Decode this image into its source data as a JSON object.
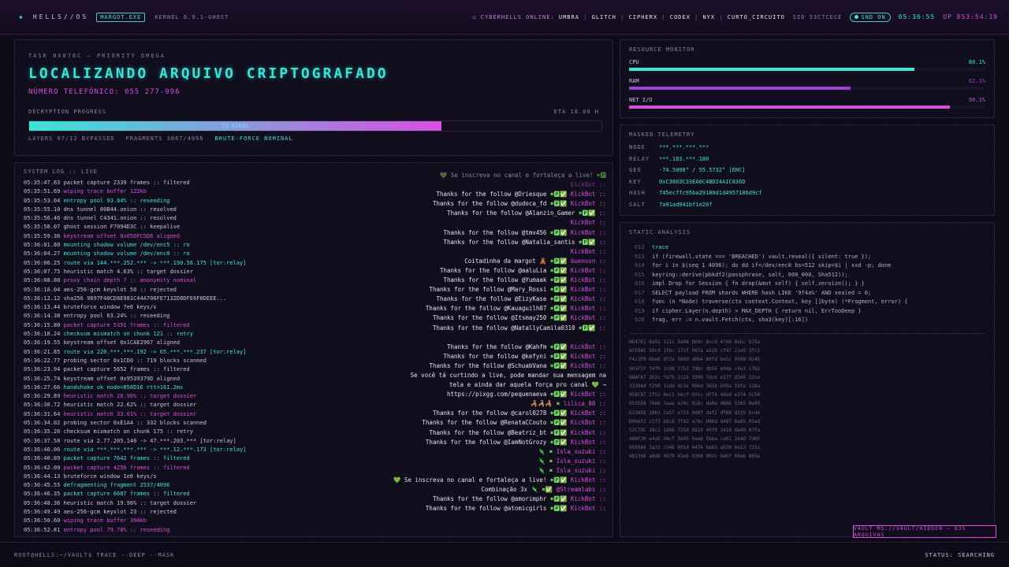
{
  "topbar": {
    "logo": "◈",
    "brand": "HELLS//OS",
    "host_badge": "MARGOT.EXE",
    "kernel": "KERNEL 6.9.1-GHOST",
    "online_icon": "network-icon",
    "online_label": "CYBERHELLS ONLINE:",
    "online_names": [
      "UMBRA",
      "GLITCH",
      "CIPHERX",
      "CODEX",
      "NYX",
      "CURTO_CIRCUITO"
    ],
    "sid": "SID 53C7CECE",
    "snd": "SND ON",
    "clock": "05:36:55",
    "uptime": "UP 853:54:19"
  },
  "task": {
    "subtitle": "TASK 0X070C — PRIORITY OMEGA",
    "title": "LOCALIZANDO ARQUIVO CRIPTOGRAFADO",
    "phone": "NÚMERO TELEFÔNICO: 055 277-996",
    "progress_label": "DECRYPTION PROGRESS",
    "eta": "ETA 18.09 H",
    "progress": 0.72,
    "progress_text": "72.8168%",
    "layers": "LAYERS 07/12 BYPASSED",
    "fragments": "FRAGMENTS 3067/4096",
    "bruteforce": "BRUTE-FORCE NOMINAL"
  },
  "syslog": {
    "header": "SYSTEM LOG :: LIVE",
    "rows": [
      {
        "t": "05:35:47.83",
        "m": "packet capture 2339 frames :: filtered",
        "c": "w"
      },
      {
        "t": "05:35:51.69",
        "m": "wiping trace buffer 122kb",
        "c": "m"
      },
      {
        "t": "05:35:53.04",
        "m": "entropy pool 93.84% :: reseeding",
        "c": "c"
      },
      {
        "t": "05:35:55.10",
        "m": "dns tunnel 80B44.onion :: resolved",
        "c": "w"
      },
      {
        "t": "05:35:56.46",
        "m": "dns tunnel C4341.onion :: resolved",
        "c": "w"
      },
      {
        "t": "05:35:58.07",
        "m": "ghost session F7094D3C :: keepalive",
        "c": "w"
      },
      {
        "t": "05:35:59.36",
        "m": "keystream offset 0x056FC5D6 aligned",
        "c": "m"
      },
      {
        "t": "05:36:01.80",
        "m": "mounting shadow volume /dev/enc5 :: ro",
        "c": "c"
      },
      {
        "t": "05:36:04.27",
        "m": "mounting shadow volume /dev/enc0 :: ro",
        "c": "c"
      },
      {
        "t": "05:36:06.25",
        "m": "route via 144.***.252.*** -> ***.190.56.175 [tor:relay]",
        "c": "c"
      },
      {
        "t": "05:36:07.75",
        "m": "heuristic match 4.63% :: target dossier",
        "c": "w"
      },
      {
        "t": "05:36:08.80",
        "m": "proxy chain depth 7 :: anonymity nominal",
        "c": "m"
      },
      {
        "t": "05:36:10.04",
        "m": "aes-256-gcm keyslot 50 :: rejected",
        "c": "w"
      },
      {
        "t": "05:36:12.12",
        "m": "sha256 9897F40CD8E981C44A706FE7132D8DFE6F8DEEE...",
        "c": "w"
      },
      {
        "t": "05:36:13.44",
        "m": "bruteforce window 7e6 keys/s",
        "c": "w"
      },
      {
        "t": "05:36:14.38",
        "m": "entropy pool 63.24% :: reseeding",
        "c": "w"
      },
      {
        "t": "05:36:15.80",
        "m": "packet capture 5351 frames :: filtered",
        "c": "m"
      },
      {
        "t": "05:36:18.24",
        "m": "checksum mismatch on chunk 121 :: retry",
        "c": "c"
      },
      {
        "t": "05:36:19.55",
        "m": "keystream offset 0x1CAE2967 aligned",
        "c": "w"
      },
      {
        "t": "05:36:21.85",
        "m": "route via 220.***.***.192 -> 65.***.***.237 [tor:relay]",
        "c": "c"
      },
      {
        "t": "05:36:22.77",
        "m": "probing sector 0x1CD0 :: 719 blocks scanned",
        "c": "w"
      },
      {
        "t": "05:36:23.94",
        "m": "packet capture 5652 frames :: filtered",
        "c": "w"
      },
      {
        "t": "05:36:25.74",
        "m": "keystream offset 0x9539379D aligned",
        "c": "w"
      },
      {
        "t": "05:36:27.66",
        "m": "handshake ok node=858D1E rtt=161.2ms",
        "c": "c"
      },
      {
        "t": "05:36:29.89",
        "m": "heuristic match 28.96% :: target dossier",
        "c": "m"
      },
      {
        "t": "05:36:30.72",
        "m": "heuristic match 22.62% :: target dossier",
        "c": "w"
      },
      {
        "t": "05:36:31.64",
        "m": "heuristic match 33.01% :: target dossier",
        "c": "m"
      },
      {
        "t": "05:36:34.02",
        "m": "probing sector 0xE1A4 :: 332 blocks scanned",
        "c": "w"
      },
      {
        "t": "05:36:35.26",
        "m": "checksum mismatch on chunk 175 :: retry",
        "c": "w"
      },
      {
        "t": "05:36:37.58",
        "m": "route via 2.77.205.140 -> 47.***.203.*** [tor:relay]",
        "c": "w"
      },
      {
        "t": "05:36:40.06",
        "m": "route via ***.***.***.*** -> ***.12.***.173 [tor:relay]",
        "c": "c"
      },
      {
        "t": "05:36:40.89",
        "m": "packet capture 7642 frames :: filtered",
        "c": "c"
      },
      {
        "t": "05:36:42.09",
        "m": "packet capture 4256 frames :: filtered",
        "c": "m"
      },
      {
        "t": "05:36:44.13",
        "m": "bruteforce window 1e6 keys/s",
        "c": "w"
      },
      {
        "t": "05:36:45.55",
        "m": "defragmenting fragment 2537/4096",
        "c": "c"
      },
      {
        "t": "05:36:46.35",
        "m": "packet capture 6687 frames :: filtered",
        "c": "c"
      },
      {
        "t": "05:36:48.36",
        "m": "heuristic match 19.96% :: target dossier",
        "c": "w"
      },
      {
        "t": "05:36:49.49",
        "m": "aes-256-gcm keyslot 23 :: rejected",
        "c": "w"
      },
      {
        "t": "05:36:50.60",
        "m": "wiping trace buffer 304kb",
        "c": "m"
      },
      {
        "t": "05:36:52.81",
        "m": "entropy pool 79.78% :: reseeding",
        "c": "m"
      }
    ]
  },
  "chat": {
    "rows": [
      {
        "text": "💚 Se inscreva no canal e fortaleça a live!",
        "icons": "✖🅿",
        "user": "",
        "dim": true
      },
      {
        "text": "",
        "icons": "",
        "user": "KickBot ::",
        "dim": true
      },
      {
        "text": "Thanks for the follow @Driesque",
        "icons": "✖🅿✅",
        "user": "KickBot ::",
        "dim": false
      },
      {
        "text": "Thanks for the follow @dudoca_fd",
        "icons": "✖🅿✅",
        "user": "KickBot ::",
        "dim": false
      },
      {
        "text": "Thanks for the follow @Alanzin_Gamer",
        "icons": "✖🅿✅",
        "user": "::",
        "dim": false
      },
      {
        "text": "",
        "icons": "",
        "user": "KickBot ::",
        "dim": false
      },
      {
        "text": "Thanks for the follow @tmv456",
        "icons": "✖🅿✅",
        "user": "KickBot ::",
        "dim": false
      },
      {
        "text": "Thanks for the follow @Natalia_santis",
        "icons": "✖🅿✅",
        "user": "::",
        "dim": false
      },
      {
        "text": "",
        "icons": "",
        "user": "KickBot ::",
        "dim": false
      },
      {
        "text": "Coitadinha da margot 🧸",
        "icons": "✖🅿✅",
        "user": "buenosn ::",
        "dim": false
      },
      {
        "text": "Thanks for the follow @aaluLia",
        "icons": "✖🅿✅",
        "user": "KickBot ::",
        "dim": false
      },
      {
        "text": "Thanks for the follow @Yumaak",
        "icons": "✖🅿✅",
        "user": "KickBot ::",
        "dim": false
      },
      {
        "text": "Thanks for the follow @Mary_Rossi",
        "icons": "✖🅿✅",
        "user": "KickBot ::",
        "dim": false
      },
      {
        "text": "Thanks for the follow @EizyKase",
        "icons": "✖🅿✅",
        "user": "KickBot ::",
        "dim": false
      },
      {
        "text": "Thanks for the follow @Kauaguilh07",
        "icons": "✖🅿✅",
        "user": "KickBot ::",
        "dim": false
      },
      {
        "text": "Thanks for the follow @Itsmay250",
        "icons": "✖🅿✅",
        "user": "KickBot ::",
        "dim": false
      },
      {
        "text": "Thanks for the follow @NatallyCamila0310",
        "icons": "✖🅿✅",
        "user": "::",
        "dim": false
      },
      {
        "text": "",
        "icons": "",
        "user": "",
        "dim": false
      },
      {
        "text": "Thanks for the follow @Kahfm",
        "icons": "✖🅿✅",
        "user": "KickBot ::",
        "dim": false
      },
      {
        "text": "Thanks for the follow @kefyni",
        "icons": "✖🅿✅",
        "user": "KickBot ::",
        "dim": false
      },
      {
        "text": "Thanks for the follow @SchuabVana",
        "icons": "✖🅿✅",
        "user": "KickBot ::",
        "dim": false
      },
      {
        "text": "Se você tá curtindo a live, pode mandar sua mensagem na",
        "icons": "",
        "user": "",
        "dim": false
      },
      {
        "text": "tela e ainda dar aquela força pro canal 💚 →",
        "icons": "",
        "user": "",
        "dim": false
      },
      {
        "text": "https://pixgg.com/pequenaeva",
        "icons": "✖🅿✅",
        "user": "KickBot ::",
        "dim": false
      },
      {
        "text": "🦂🦂🦂",
        "icons": "✖",
        "user": "lilica_80 ::",
        "dim": false
      },
      {
        "text": "Thanks for the follow @carol0278",
        "icons": "✖🅿✅",
        "user": "KickBot ::",
        "dim": false
      },
      {
        "text": "Thanks for the follow @RenataCCouto",
        "icons": "✖🅿✅",
        "user": "KickBot ::",
        "dim": false
      },
      {
        "text": "Thanks for the follow @Beatriz_bt",
        "icons": "✖🅿✅",
        "user": "KickBot ::",
        "dim": false
      },
      {
        "text": "Thanks for the follow @IamNotGrozy",
        "icons": "✖🅿✅",
        "user": "KickBot ::",
        "dim": false
      },
      {
        "text": "🦎",
        "icons": "✖",
        "user": "Isla_suzuki ::",
        "dim": false
      },
      {
        "text": "🦎",
        "icons": "✖",
        "user": "Isla_suzuki ::",
        "dim": false
      },
      {
        "text": "🦎",
        "icons": "✖",
        "user": "Isla_suzuki ::",
        "dim": false
      },
      {
        "text": "💚 Se inscreva no canal e fortaleça a live!",
        "icons": "✖🅿✅",
        "user": "KickBot ::",
        "dim": false
      },
      {
        "text": "Combinação 3x 🦎",
        "icons": "✖✅",
        "user": "@Streamlabs ::",
        "dim": false
      },
      {
        "text": "Thanks for the follow @amorimphr",
        "icons": "✖🅿✅",
        "user": "KickBot ::",
        "dim": false
      },
      {
        "text": "Thanks for the follow @atomicgirls",
        "icons": "✖🅿✅",
        "user": "KickBot ::",
        "dim": false
      }
    ]
  },
  "resources": {
    "header": "RESOURCE MONITOR",
    "meters": [
      {
        "name": "CPU",
        "value": 80.1,
        "label": "80.1%",
        "color": "#39e5d6"
      },
      {
        "name": "RAM",
        "value": 62.1,
        "label": "62.1%",
        "color": "#9b3fe0"
      },
      {
        "name": "NET I/O",
        "value": 90.1,
        "label": "90.1%",
        "color": "#d84fe0"
      }
    ]
  },
  "telemetry": {
    "header": "MASKED TELEMETRY",
    "rows": [
      {
        "k": "NODE",
        "v": "***.***.***.***"
      },
      {
        "k": "RELAY",
        "v": "***.183.***.180"
      },
      {
        "k": "GEO",
        "v": "-74.5098° / 55.5732° [ENC]"
      },
      {
        "k": "KEY",
        "v": "0xC3863C33EA6C4BD24A1C836D"
      },
      {
        "k": "HASH",
        "v": "745ecffc95ba29180d1d4957186d9cf"
      },
      {
        "k": "SALT",
        "v": "7a91ad941bf1e20f"
      }
    ]
  },
  "static_analysis": {
    "header": "STATIC ANALYSIS",
    "code": [
      {
        "ln": "012",
        "tx": "trace",
        "hl": true
      },
      {
        "ln": "013",
        "tx": "if (firewall.state === 'BREACHED') vault.reseal({ silent: true });",
        "hl": false
      },
      {
        "ln": "014",
        "tx": "for i in $(seq 1 4096); do dd if=/dev/enc0 bs=512 skip=$i | xxd -p; done",
        "hl": false
      },
      {
        "ln": "015",
        "tx": "keyring::derive(pbkdf2(passphrase, salt, 600_000, Sha512));",
        "hl": false
      },
      {
        "ln": "016",
        "tx": "impl Drop for Session { fn drop(&mut self) { self.zeroize(); } }",
        "hl": false
      },
      {
        "ln": "017",
        "tx": "SELECT payload FROM shards WHERE hash LIKE '9f4a%' AND sealed = 0;",
        "hl": false
      },
      {
        "ln": "018",
        "tx": "func (n *Node) traverse(ctx context.Context, key []byte) (*Fragment, error) {",
        "hl": false
      },
      {
        "ln": "019",
        "tx": "if cipher.Layer(n.depth) > MAX_DEPTH { return nil, ErrTooDeep }",
        "hl": false
      },
      {
        "ln": "020",
        "tx": "frag, err := n.vault.Fetch(ctx, sha3(key)[:16])",
        "hl": false
      }
    ],
    "hex": [
      "0E47E1 8a91 111c 5d46 bb9c 8ccd 4704 8ebc b75a",
      "ACE0A5 50cd 15bc 173f 987a a226 cf47 21e9 3fc1",
      "F413F0 bbe6 df2a 580d d0b4 80fd be5c 9500 9245",
      "361FCF f4f0 1c98 77b3 7dbc db56 e0de c4e3 17b2",
      "6BAFA7 2b2c fd79 311b 1900 7dc6 e27f d349 22ce",
      "3320A4 f290 11dd dc3e 096d 365b 609a 19fe 128a",
      "058C87 2f52 8ec1 b6cf 031c dff4 46ed e374 9c50",
      "055EE8 70eb 1aaa e20c b18c da6e d66b 5365 0ed9",
      "E230E6 19b3 2a57 e719 0d0f daf2 df68 d335 bcd4",
      "D066F2 c1f3 6dc8 7f92 a78c 088d 848f 6e85 01ed",
      "52C79C 28c2 1966 725d 8819 40f0 1419 da49 07fa",
      "406F20 e4a5 d4cf 3a95 5ee6 5bba ce01 2e4d 7d65",
      "0503A9 1a33 c548 891d 4474 be83 a530 be13 7251",
      "A81366 a8d6 4979 42e6 6368 902c 6ebf 09a6 865e"
    ]
  },
  "vault": "VAULT MS://VAULT/HIDDEN — 835 ARQUIVOS",
  "bottombar": {
    "prompt": "ROOT@HELLS:~/VAULT$ TRACE --DEEP --MASK",
    "status_label": "STATUS:",
    "status_value": "SEARCHING"
  }
}
